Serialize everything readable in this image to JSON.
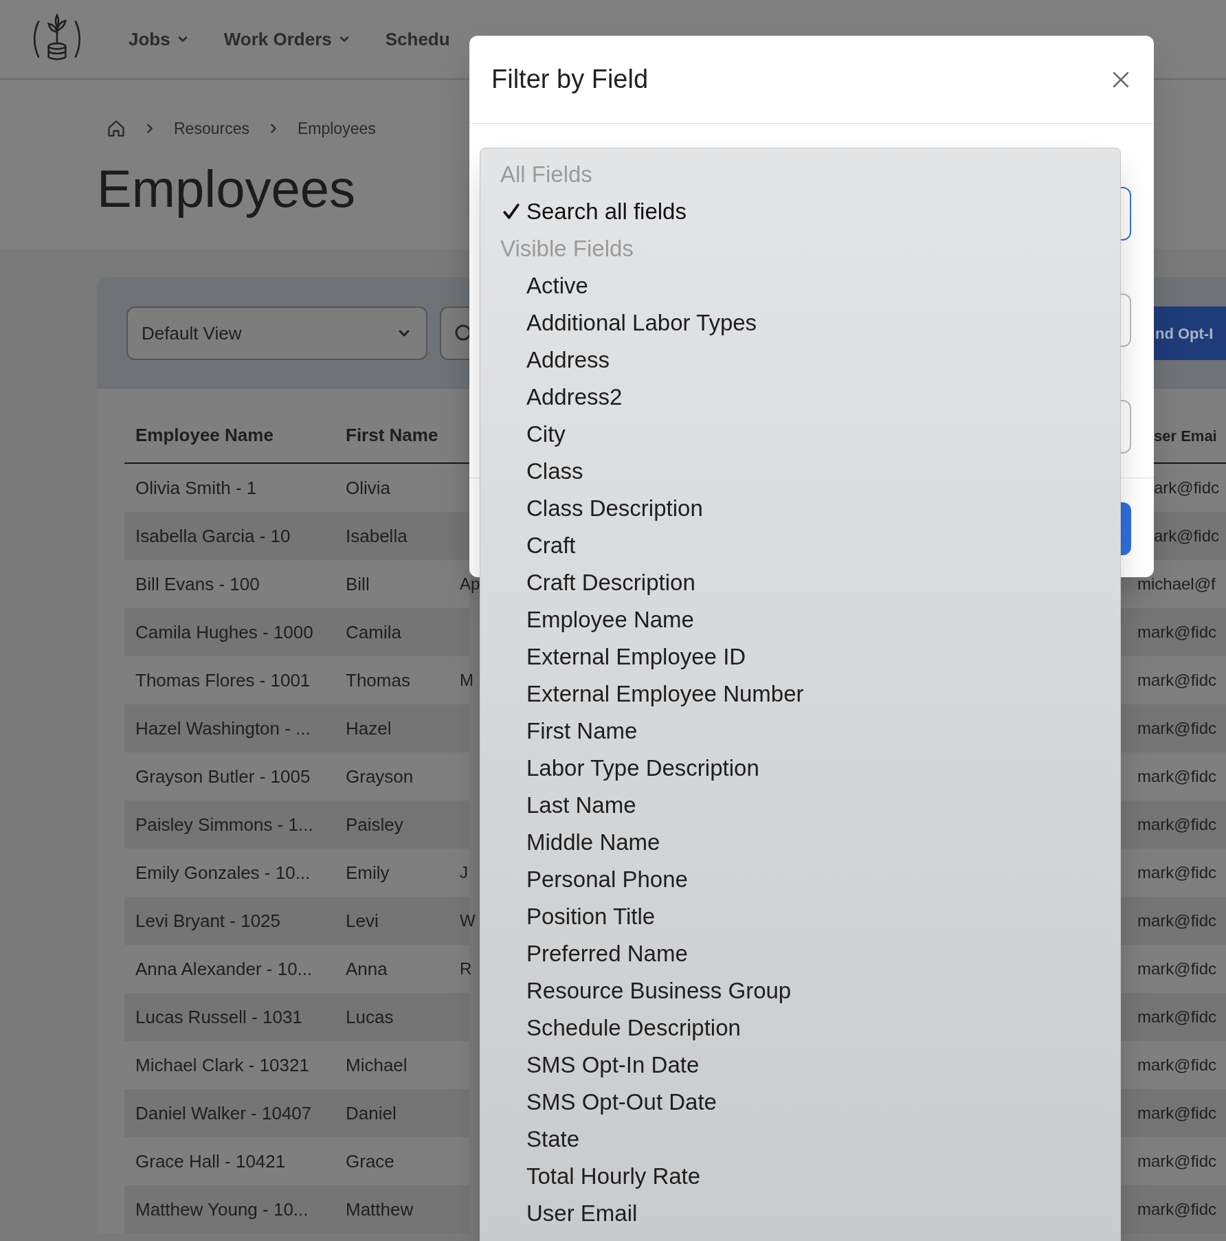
{
  "nav": {
    "items": [
      {
        "label": "Jobs",
        "dropdown": true
      },
      {
        "label": "Work Orders",
        "dropdown": true
      },
      {
        "label": "Schedu",
        "dropdown": false
      }
    ]
  },
  "breadcrumb": [
    "Resources",
    "Employees"
  ],
  "page_title": "Employees",
  "toolbar": {
    "view_select": "Default View",
    "action_button": "nd Opt-I"
  },
  "table": {
    "columns": [
      "Employee Name",
      "First Name",
      "ser Emai"
    ],
    "rows": [
      {
        "name": "Olivia Smith - 1",
        "first": "Olivia",
        "email": "ark@fidc"
      },
      {
        "name": "Isabella Garcia - 10",
        "first": "Isabella",
        "email": "ark@fidc"
      },
      {
        "name": "Bill Evans - 100",
        "first": "Bill",
        "column_3": "Ap",
        "email": "michael@f"
      },
      {
        "name": "Camila Hughes - 1000",
        "first": "Camila",
        "email": "mark@fidc"
      },
      {
        "name": "Thomas Flores - 1001",
        "first": "Thomas",
        "column_3": "M",
        "email": "mark@fidc"
      },
      {
        "name": "Hazel Washington - ...",
        "first": "Hazel",
        "email": "mark@fidc"
      },
      {
        "name": "Grayson Butler - 1005",
        "first": "Grayson",
        "email": "mark@fidc"
      },
      {
        "name": "Paisley Simmons - 1...",
        "first": "Paisley",
        "email": "mark@fidc"
      },
      {
        "name": "Emily Gonzales - 10...",
        "first": "Emily",
        "column_3": "J",
        "email": "mark@fidc"
      },
      {
        "name": "Levi Bryant - 1025",
        "first": "Levi",
        "column_3": "W",
        "email": "mark@fidc"
      },
      {
        "name": "Anna Alexander - 10...",
        "first": "Anna",
        "column_3": "R",
        "email": "mark@fidc"
      },
      {
        "name": "Lucas Russell - 1031",
        "first": "Lucas",
        "email": "mark@fidc"
      },
      {
        "name": "Michael Clark - 10321",
        "first": "Michael",
        "email": "mark@fidc"
      },
      {
        "name": "Daniel Walker - 10407",
        "first": "Daniel",
        "email": "mark@fidc"
      },
      {
        "name": "Grace Hall - 10421",
        "first": "Grace",
        "email": "mark@fidc"
      },
      {
        "name": "Matthew Young - 10...",
        "first": "Matthew",
        "email": "mark@fidc"
      }
    ]
  },
  "modal": {
    "title": "Filter by Field",
    "dropdown": [
      {
        "label": "All Fields",
        "options": [
          {
            "label": "Search all fields",
            "selected": true
          }
        ]
      },
      {
        "label": "Visible Fields",
        "options": [
          {
            "label": "Active",
            "selected": false
          },
          {
            "label": "Additional Labor Types",
            "selected": false
          },
          {
            "label": "Address",
            "selected": false
          },
          {
            "label": "Address2",
            "selected": false
          },
          {
            "label": "City",
            "selected": false
          },
          {
            "label": "Class",
            "selected": false
          },
          {
            "label": "Class Description",
            "selected": false
          },
          {
            "label": "Craft",
            "selected": false
          },
          {
            "label": "Craft Description",
            "selected": false
          },
          {
            "label": "Employee Name",
            "selected": false
          },
          {
            "label": "External Employee ID",
            "selected": false
          },
          {
            "label": "External Employee Number",
            "selected": false
          },
          {
            "label": "First Name",
            "selected": false
          },
          {
            "label": "Labor Type Description",
            "selected": false
          },
          {
            "label": "Last Name",
            "selected": false
          },
          {
            "label": "Middle Name",
            "selected": false
          },
          {
            "label": "Personal Phone",
            "selected": false
          },
          {
            "label": "Position Title",
            "selected": false
          },
          {
            "label": "Preferred Name",
            "selected": false
          },
          {
            "label": "Resource Business Group",
            "selected": false
          },
          {
            "label": "Schedule Description",
            "selected": false
          },
          {
            "label": "SMS Opt-In Date",
            "selected": false
          },
          {
            "label": "SMS Opt-Out Date",
            "selected": false
          },
          {
            "label": "State",
            "selected": false
          },
          {
            "label": "Total Hourly Rate",
            "selected": false
          },
          {
            "label": "User Email",
            "selected": false
          }
        ]
      }
    ]
  }
}
